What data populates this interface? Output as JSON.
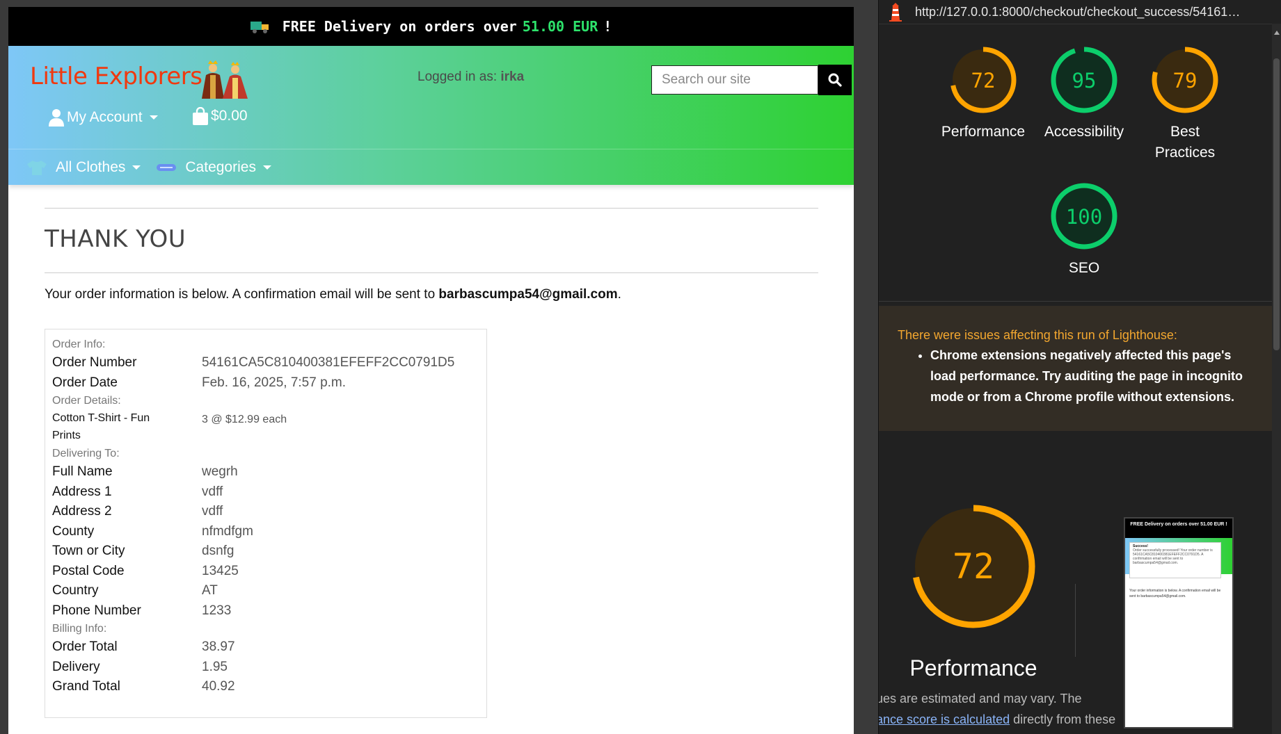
{
  "site": {
    "topbar": {
      "text_before": "FREE Delivery on orders over",
      "amount": "51.00 EUR",
      "text_after": "!"
    },
    "logo": "Little Explorers",
    "logged_in": {
      "prefix": "Logged in as:",
      "user": "irka"
    },
    "search": {
      "placeholder": "Search our site"
    },
    "account_label": "My Account",
    "cart_total": "$0.00",
    "nav": {
      "all_clothes": "All Clothes",
      "categories": "Categories"
    },
    "page_title": "THANK YOU",
    "intro": {
      "text": "Your order information is below. A confirmation email will be sent to",
      "email": "barbascumpa54@gmail.com",
      "end": "."
    },
    "order": {
      "info_heading": "Order Info:",
      "number_label": "Order Number",
      "number": "54161CA5C810400381EFEFF2CC0791D5",
      "date_label": "Order Date",
      "date": "Feb. 16, 2025, 7:57 p.m.",
      "details_heading": "Order Details:",
      "item_name": "Cotton T-Shirt - Fun Prints",
      "item_qty": "3 @ $12.99 each",
      "delivering_heading": "Delivering To:",
      "delivery": [
        {
          "label": "Full Name",
          "value": "wegrh"
        },
        {
          "label": "Address 1",
          "value": "vdff"
        },
        {
          "label": "Address 2",
          "value": "vdff"
        },
        {
          "label": "County",
          "value": "nfmdfgm"
        },
        {
          "label": "Town or City",
          "value": "dsnfg"
        },
        {
          "label": "Postal Code",
          "value": "13425"
        },
        {
          "label": "Country",
          "value": "AT"
        },
        {
          "label": "Phone Number",
          "value": "1233"
        }
      ],
      "billing_heading": "Billing Info:",
      "billing": [
        {
          "label": "Order Total",
          "value": "38.97"
        },
        {
          "label": "Delivery",
          "value": "1.95"
        },
        {
          "label": "Grand Total",
          "value": "40.92"
        }
      ]
    }
  },
  "lighthouse": {
    "url": "http://127.0.0.1:8000/checkout/checkout_success/54161…",
    "scores": [
      {
        "label": "Performance",
        "value": 72,
        "color": "#ffa400"
      },
      {
        "label": "Accessibility",
        "value": 95,
        "color": "#0cce6b"
      },
      {
        "label": "Best Practices",
        "value": 79,
        "color": "#ffa400"
      },
      {
        "label": "SEO",
        "value": 100,
        "color": "#0cce6b"
      }
    ],
    "warning_title": "There were issues affecting this run of Lighthouse:",
    "warning_item": "Chrome extensions negatively affected this page's load performance. Try auditing the page in incognito mode or from a Chrome profile without extensions.",
    "big_score": {
      "label": "Performance",
      "value": 72
    },
    "footer_line1": "ues are estimated and may vary. The",
    "footer_link": "ance score is calculated",
    "footer_line2": "directly from these",
    "thumb_banner": "FREE Delivery on orders over 51.00 EUR !",
    "thumb_toast": "Success!",
    "thumb_toast_body": "Order successfully processed! Your order number is 54161CA5C810400381EFEFF2CC0791D5. A confirmation email will be sent to barbascumpa54@gmail.com.",
    "thumb_text": "Your order information is below. A confirmation email will be sent to barbascumpa54@gmail.com."
  }
}
